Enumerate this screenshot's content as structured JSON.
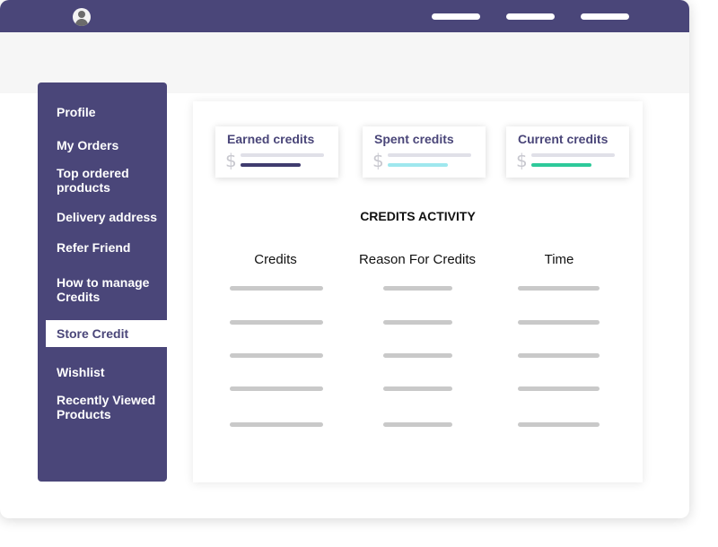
{
  "colors": {
    "brand": "#4a4679",
    "earned_bar": "#3f3b6e",
    "spent_bar": "#9fe8ee",
    "current_bar": "#2ec99a"
  },
  "header": {
    "avatar_icon": "user-avatar-icon",
    "nav_items": [
      "",
      "",
      ""
    ]
  },
  "sidebar": {
    "items": [
      {
        "label": "Profile"
      },
      {
        "label": "My Orders"
      },
      {
        "label": "Top ordered products"
      },
      {
        "label": "Delivery address"
      },
      {
        "label": "Refer Friend"
      },
      {
        "label": "How to manage Credits"
      },
      {
        "label": "Store Credit",
        "active": true
      },
      {
        "label": "Wishlist"
      },
      {
        "label": "Recently Viewed Products"
      }
    ]
  },
  "cards": [
    {
      "title": "Earned credits",
      "icon": "dollar-icon"
    },
    {
      "title": "Spent credits",
      "icon": "dollar-icon"
    },
    {
      "title": "Current credits",
      "icon": "dollar-icon"
    }
  ],
  "activity": {
    "title": "CREDITS ACTIVITY",
    "columns": [
      "Credits",
      "Reason For Credits",
      "Time"
    ],
    "row_count": 5
  }
}
